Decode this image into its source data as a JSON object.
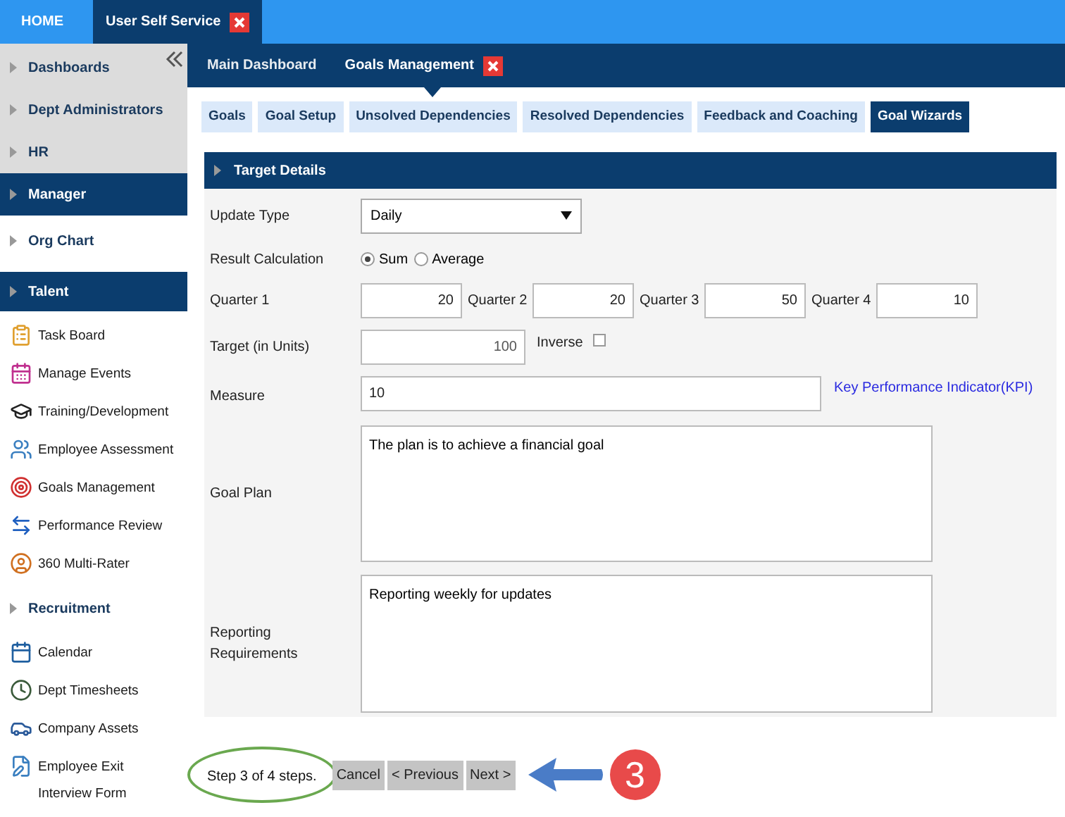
{
  "top_tabs": [
    {
      "label": "HOME",
      "selected": false,
      "closable": false
    },
    {
      "label": "User Self Service",
      "selected": true,
      "closable": true
    }
  ],
  "sidebar": {
    "items": [
      {
        "label": "Dashboards",
        "kind": "section",
        "selected": false
      },
      {
        "label": "Dept Administrators",
        "kind": "section",
        "selected": false
      },
      {
        "label": "HR",
        "kind": "section",
        "selected": false
      },
      {
        "label": "Manager",
        "kind": "section",
        "selected": true,
        "children": [
          {
            "label": "Org Chart",
            "kind": "section",
            "selected": false
          },
          {
            "label": "Talent",
            "kind": "section",
            "selected": true,
            "children": [
              {
                "label": "Task Board",
                "kind": "link"
              },
              {
                "label": "Manage Events",
                "kind": "link"
              },
              {
                "label": "Training/Development",
                "kind": "link"
              },
              {
                "label": "Employee Assessment",
                "kind": "link"
              },
              {
                "label": "Goals Management",
                "kind": "link"
              },
              {
                "label": "Performance Review",
                "kind": "link"
              },
              {
                "label": "360 Multi-Rater",
                "kind": "link"
              }
            ]
          },
          {
            "label": "Recruitment",
            "kind": "section",
            "selected": false
          },
          {
            "label": "Calendar",
            "kind": "link"
          },
          {
            "label": "Dept Timesheets",
            "kind": "link"
          },
          {
            "label": "Company Assets",
            "kind": "link"
          },
          {
            "label": "Employee Exit Interview Form",
            "kind": "link"
          }
        ]
      }
    ]
  },
  "sub_tabs": [
    {
      "label": "Main Dashboard",
      "selected": false,
      "closable": false
    },
    {
      "label": "Goals Management",
      "selected": true,
      "closable": true
    }
  ],
  "page_tabs": [
    {
      "label": "Goals",
      "selected": false
    },
    {
      "label": "Goal Setup",
      "selected": false
    },
    {
      "label": "Unsolved Dependencies",
      "selected": false
    },
    {
      "label": "Resolved Dependencies",
      "selected": false
    },
    {
      "label": "Feedback and Coaching",
      "selected": false
    },
    {
      "label": "Goal Wizards",
      "selected": true
    }
  ],
  "panel": {
    "title": "Target Details",
    "update_type": {
      "label": "Update Type",
      "value": "Daily"
    },
    "result_calculation": {
      "label": "Result Calculation",
      "options": [
        {
          "label": "Sum",
          "selected": true
        },
        {
          "label": "Average",
          "selected": false
        }
      ]
    },
    "quarters": [
      {
        "label": "Quarter 1",
        "value": "20"
      },
      {
        "label": "Quarter 2",
        "value": "20"
      },
      {
        "label": "Quarter 3",
        "value": "50"
      },
      {
        "label": "Quarter 4",
        "value": "10"
      }
    ],
    "target": {
      "label": "Target (in Units)",
      "value": "100"
    },
    "inverse": {
      "label": "Inverse",
      "checked": false
    },
    "measure": {
      "label": "Measure",
      "value": "10",
      "link": "Key Performance Indicator(KPI)"
    },
    "goal_plan": {
      "label": "Goal Plan",
      "value": "The plan is to achieve a financial goal"
    },
    "reporting": {
      "label": "Reporting Requirements",
      "value": "Reporting weekly for updates"
    }
  },
  "footer": {
    "step": "Step 3 of 4 steps.",
    "buttons": [
      "Cancel",
      "< Previous",
      "Next >"
    ],
    "callout": "3"
  }
}
